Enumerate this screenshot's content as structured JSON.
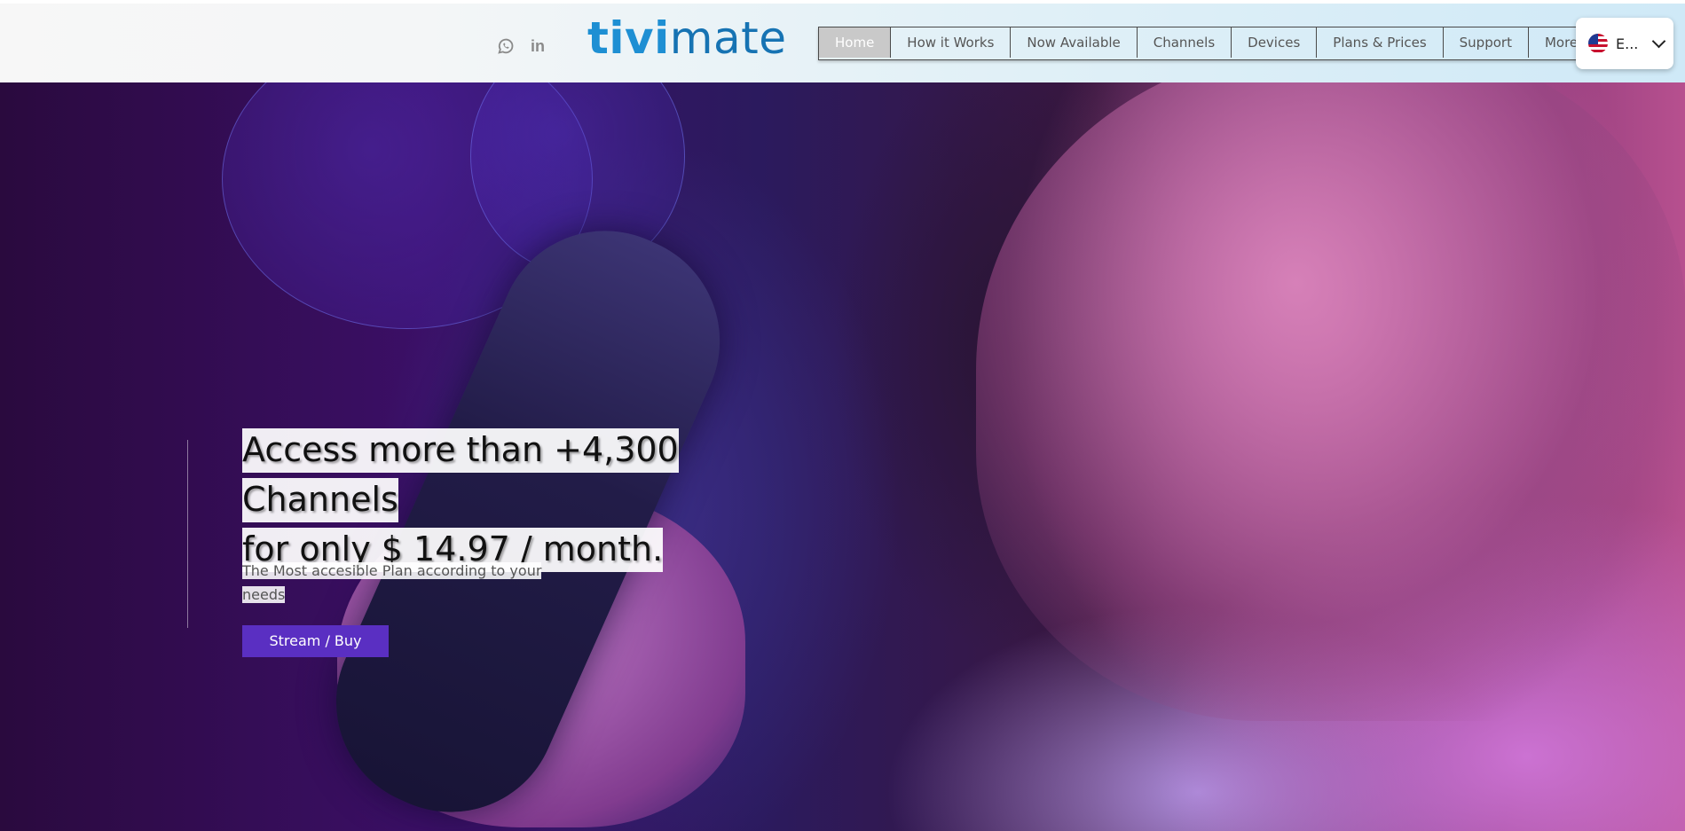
{
  "header": {
    "logo": {
      "part1": "tivi",
      "part2": "mate"
    },
    "social": [
      {
        "icon": "whatsapp-icon"
      },
      {
        "icon": "linkedin-icon",
        "label": "in"
      }
    ],
    "nav": [
      {
        "label": "Home",
        "active": true
      },
      {
        "label": "How it Works"
      },
      {
        "label": "Now Available"
      },
      {
        "label": "Channels"
      },
      {
        "label": "Devices"
      },
      {
        "label": "Plans & Prices"
      },
      {
        "label": "Support"
      },
      {
        "label": "More"
      }
    ],
    "language": {
      "label": "E...",
      "icon": "us-flag-icon"
    }
  },
  "hero": {
    "headline_line1": "Access more than +4,300 Channels",
    "headline_line2": "for only $ 14.97 / month.",
    "subtext": "The Most accesible Plan according to your needs",
    "cta_label": "Stream / Buy"
  },
  "colors": {
    "accent": "#5a2fc2",
    "logo_blue": "#1e8fd3",
    "nav_active": "#c9c9c9"
  }
}
